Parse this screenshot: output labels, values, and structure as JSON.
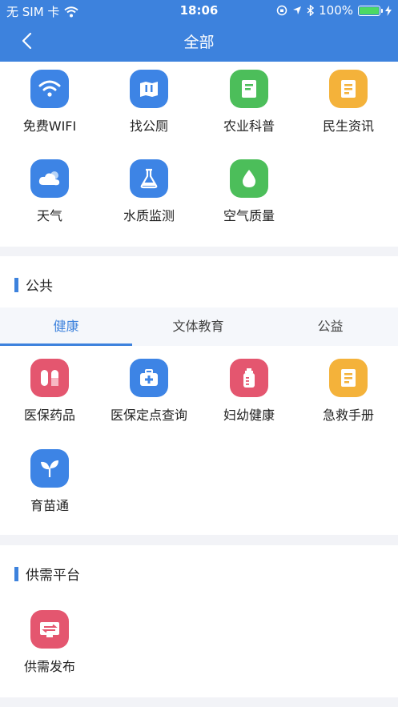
{
  "status_bar": {
    "carrier": "无 SIM 卡",
    "time": "18:06",
    "battery": "100%"
  },
  "nav": {
    "title": "全部"
  },
  "top_apps": [
    {
      "label": "免费WIFI",
      "icon": "wifi-icon",
      "color": "#3d84e5"
    },
    {
      "label": "找公厕",
      "icon": "toilet-map-icon",
      "color": "#3d84e5"
    },
    {
      "label": "农业科普",
      "icon": "document-icon",
      "color": "#4cbe5a"
    },
    {
      "label": "民生资讯",
      "icon": "news-icon",
      "color": "#f4b23a"
    },
    {
      "label": "天气",
      "icon": "weather-icon",
      "color": "#3d84e5"
    },
    {
      "label": "水质监测",
      "icon": "flask-icon",
      "color": "#3d84e5"
    },
    {
      "label": "空气质量",
      "icon": "droplet-icon",
      "color": "#4cbe5a"
    }
  ],
  "public_section": {
    "title": "公共",
    "tabs": [
      "健康",
      "文体教育",
      "公益"
    ],
    "active_tab": "健康",
    "apps": [
      {
        "label": "医保药品",
        "icon": "pill-icon",
        "color": "#e4566f"
      },
      {
        "label": "医保定点查询",
        "icon": "medkit-icon",
        "color": "#3d84e5"
      },
      {
        "label": "妇幼健康",
        "icon": "baby-bottle-icon",
        "color": "#e4566f"
      },
      {
        "label": "急救手册",
        "icon": "handbook-icon",
        "color": "#f4b23a"
      },
      {
        "label": "育苗通",
        "icon": "sprout-icon",
        "color": "#3d84e5"
      }
    ]
  },
  "supply_section": {
    "title": "供需平台",
    "apps": [
      {
        "label": "供需发布",
        "icon": "exchange-icon",
        "color": "#e4566f"
      }
    ]
  }
}
